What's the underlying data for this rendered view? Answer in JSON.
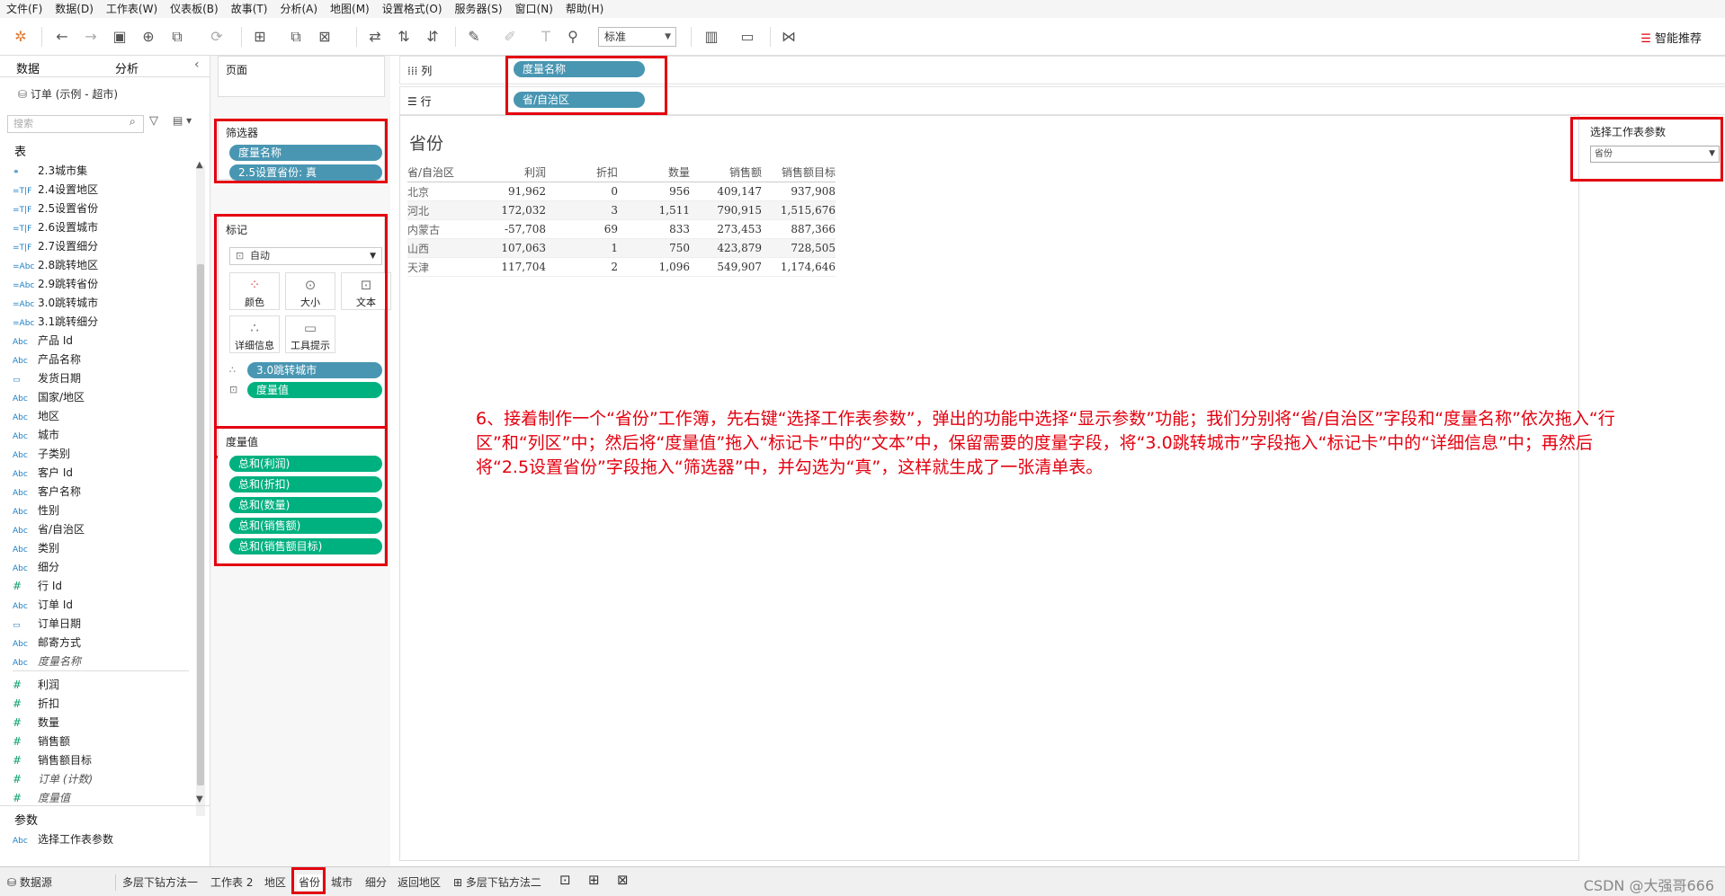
{
  "menu": [
    "文件(F)",
    "数据(D)",
    "工作表(W)",
    "仪表板(B)",
    "故事(T)",
    "分析(A)",
    "地图(M)",
    "设置格式(O)",
    "服务器(S)",
    "窗口(N)",
    "帮助(H)"
  ],
  "toolbar": {
    "fit_value": "标准",
    "smart_label": "智能推荐"
  },
  "datapane": {
    "tab_data": "数据",
    "tab_analysis": "分析",
    "datasource": "订单 (示例 - 超市)",
    "search_placeholder": "搜索",
    "tables_heading": "表",
    "fields": [
      {
        "icon": "⚭",
        "label": "2.3城市集"
      },
      {
        "icon": "=T|F",
        "label": "2.4设置地区"
      },
      {
        "icon": "=T|F",
        "label": "2.5设置省份"
      },
      {
        "icon": "=T|F",
        "label": "2.6设置城市"
      },
      {
        "icon": "=T|F",
        "label": "2.7设置细分"
      },
      {
        "icon": "=Abc",
        "label": "2.8跳转地区"
      },
      {
        "icon": "=Abc",
        "label": "2.9跳转省份"
      },
      {
        "icon": "=Abc",
        "label": "3.0跳转城市"
      },
      {
        "icon": "=Abc",
        "label": "3.1跳转细分"
      },
      {
        "icon": "Abc",
        "label": "产品 Id"
      },
      {
        "icon": "Abc",
        "label": "产品名称"
      },
      {
        "icon": "▭",
        "label": "发货日期"
      },
      {
        "icon": "Abc",
        "label": "国家/地区"
      },
      {
        "icon": "Abc",
        "label": "地区"
      },
      {
        "icon": "Abc",
        "label": "城市"
      },
      {
        "icon": "Abc",
        "label": "子类别"
      },
      {
        "icon": "Abc",
        "label": "客户 Id"
      },
      {
        "icon": "Abc",
        "label": "客户名称"
      },
      {
        "icon": "Abc",
        "label": "性别"
      },
      {
        "icon": "Abc",
        "label": "省/自治区"
      },
      {
        "icon": "Abc",
        "label": "类别"
      },
      {
        "icon": "Abc",
        "label": "细分"
      },
      {
        "icon": "#",
        "label": "行 Id"
      },
      {
        "icon": "Abc",
        "label": "订单 Id"
      },
      {
        "icon": "▭",
        "label": "订单日期"
      },
      {
        "icon": "Abc",
        "label": "邮寄方式"
      },
      {
        "icon": "Abc",
        "label": "度量名称"
      }
    ],
    "measures": [
      {
        "icon": "#",
        "label": "利润"
      },
      {
        "icon": "#",
        "label": "折扣"
      },
      {
        "icon": "#",
        "label": "数量"
      },
      {
        "icon": "#",
        "label": "销售额"
      },
      {
        "icon": "#",
        "label": "销售额目标"
      },
      {
        "icon": "#",
        "label": "订单 (计数)"
      },
      {
        "icon": "#",
        "label": "度量值"
      }
    ],
    "params_heading": "参数",
    "param_field": {
      "icon": "Abc",
      "label": "选择工作表参数"
    }
  },
  "shelves": {
    "pages": "页面",
    "columns_label": "列",
    "rows_label": "行",
    "columns_pill": "度量名称",
    "rows_pill": "省/自治区",
    "filters_title": "筛选器",
    "filters": [
      "度量名称",
      "2.5设置省份: 真"
    ],
    "marks_title": "标记",
    "mark_type": "自动",
    "mark_buttons": [
      "颜色",
      "大小",
      "文本",
      "详细信息",
      "工具提示"
    ],
    "mark_pills": [
      {
        "label": "3.0跳转城市",
        "color": "blue"
      },
      {
        "label": "度量值",
        "color": "green"
      }
    ],
    "measure_values_title": "度量值",
    "measure_values": [
      "总和(利润)",
      "总和(折扣)",
      "总和(数量)",
      "总和(销售额)",
      "总和(销售额目标)"
    ]
  },
  "view": {
    "title": "省份",
    "headers": [
      "省/自治区",
      "利润",
      "折扣",
      "数量",
      "销售额",
      "销售额目标"
    ],
    "rows": [
      [
        "北京",
        "91,962",
        "0",
        "956",
        "409,147",
        "937,908"
      ],
      [
        "河北",
        "172,032",
        "3",
        "1,511",
        "790,915",
        "1,515,676"
      ],
      [
        "内蒙古",
        "-57,708",
        "69",
        "833",
        "273,453",
        "887,366"
      ],
      [
        "山西",
        "107,063",
        "1",
        "750",
        "423,879",
        "728,505"
      ],
      [
        "天津",
        "117,704",
        "2",
        "1,096",
        "549,907",
        "1,174,646"
      ]
    ]
  },
  "parameter_control": {
    "title": "选择工作表参数",
    "value": "省份"
  },
  "annotation": "6、接着制作一个“省份”工作簿，先右键“选择工作表参数”，弹出的功能中选择“显示参数”功能；我们分别将“省/自治区”字段和“度量名称”依次拖入“行区”和“列区”中；然后将“度量值”拖入“标记卡”中的“文本”中，保留需要的度量字段，将“3.0跳转城市”字段拖入“标记卡”中的“详细信息”中；再然后将“2.5设置省份”字段拖入“筛选器”中，并勾选为“真”，这样就生成了一张清单表。",
  "sheet_tabs": {
    "datasource": "数据源",
    "tabs": [
      "多层下钻方法一",
      "工作表 2",
      "地区",
      "省份",
      "城市",
      "细分",
      "返回地区",
      "多层下钻方法二"
    ],
    "active": "省份"
  },
  "watermark": "CSDN @大强哥666",
  "colors": {
    "pill_blue": "#4996b2",
    "pill_green": "#00b180",
    "highlight_red": "#e3000f"
  }
}
